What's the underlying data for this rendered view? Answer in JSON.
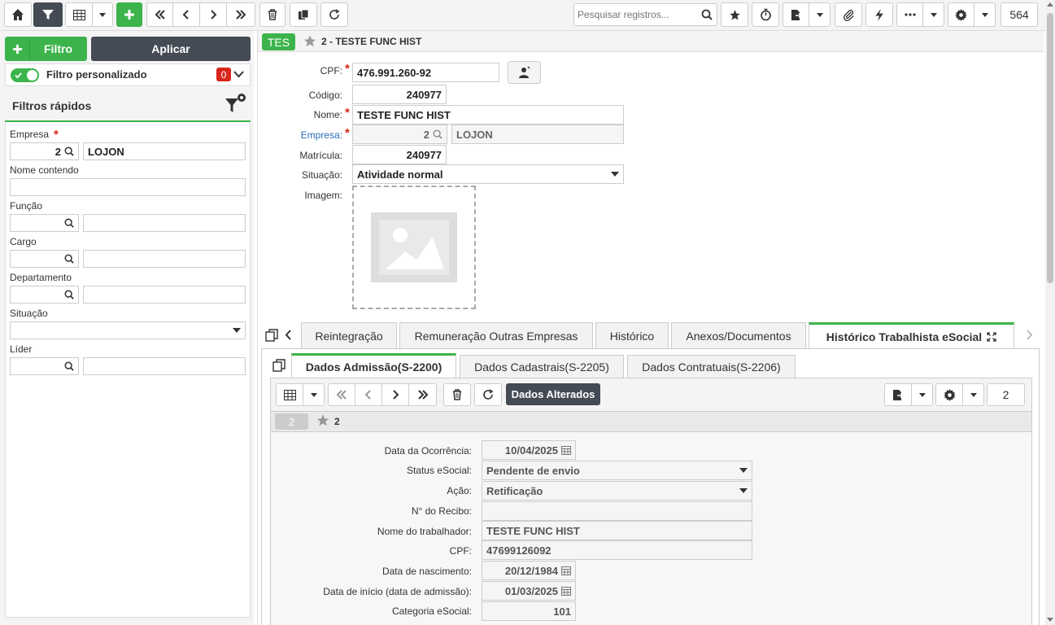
{
  "toolbar": {
    "search_placeholder": "Pesquisar registros...",
    "record_count": "564"
  },
  "sidebar": {
    "filter_btn": "Filtro",
    "apply_btn": "Aplicar",
    "custom_filter": "Filtro personalizado",
    "custom_filter_count": "0",
    "quick_filters_title": "Filtros rápidos",
    "fields": {
      "empresa_label": "Empresa",
      "empresa_code": "2",
      "empresa_name": "LOJON",
      "nome_label": "Nome contendo",
      "funcao_label": "Função",
      "cargo_label": "Cargo",
      "departamento_label": "Departamento",
      "situacao_label": "Situação",
      "lider_label": "Líder"
    }
  },
  "record": {
    "badge": "TES",
    "title": "2 - TESTE FUNC HIST",
    "cpf_label": "CPF:",
    "cpf": "476.991.260-92",
    "codigo_label": "Código:",
    "codigo": "240977",
    "nome_label": "Nome:",
    "nome": "TESTE FUNC HIST",
    "empresa_label": "Empresa:",
    "empresa_code": "2",
    "empresa_name": "LOJON",
    "matricula_label": "Matrícula:",
    "matricula": "240977",
    "situacao_label": "Situação:",
    "situacao": "Atividade normal",
    "imagem_label": "Imagem:"
  },
  "tabs": [
    "Reintegração",
    "Remuneração Outras Empresas",
    "Histórico",
    "Anexos/Documentos",
    "Histórico Trabalhista eSocial"
  ],
  "subtabs": [
    "Dados Admissão(S-2200)",
    "Dados Cadastrais(S-2205)",
    "Dados Contratuais(S-2206)"
  ],
  "subtoolbar": {
    "changed_btn": "Dados Alterados",
    "count": "2"
  },
  "subrecord": {
    "badge": "2",
    "title": "2"
  },
  "esocial": {
    "data_ocorrencia_label": "Data da Ocorrência:",
    "data_ocorrencia": "10/04/2025",
    "status_label": "Status eSocial:",
    "status": "Pendente de envio",
    "acao_label": "Ação:",
    "acao": "Retificação",
    "recibo_label": "N° do Recibo:",
    "recibo": "",
    "nome_label": "Nome do trabalhador:",
    "nome": "TESTE FUNC HIST",
    "cpf_label": "CPF:",
    "cpf": "47699126092",
    "nascimento_label": "Data de nascimento:",
    "nascimento": "20/12/1984",
    "inicio_label": "Data de início (data de admissão):",
    "inicio": "01/03/2025",
    "categoria_label": "Categoria eSocial:",
    "categoria": "101"
  },
  "colors": {
    "accent_green": "#3cb44b",
    "dark": "#444b55",
    "badge_red": "#d9261c"
  }
}
